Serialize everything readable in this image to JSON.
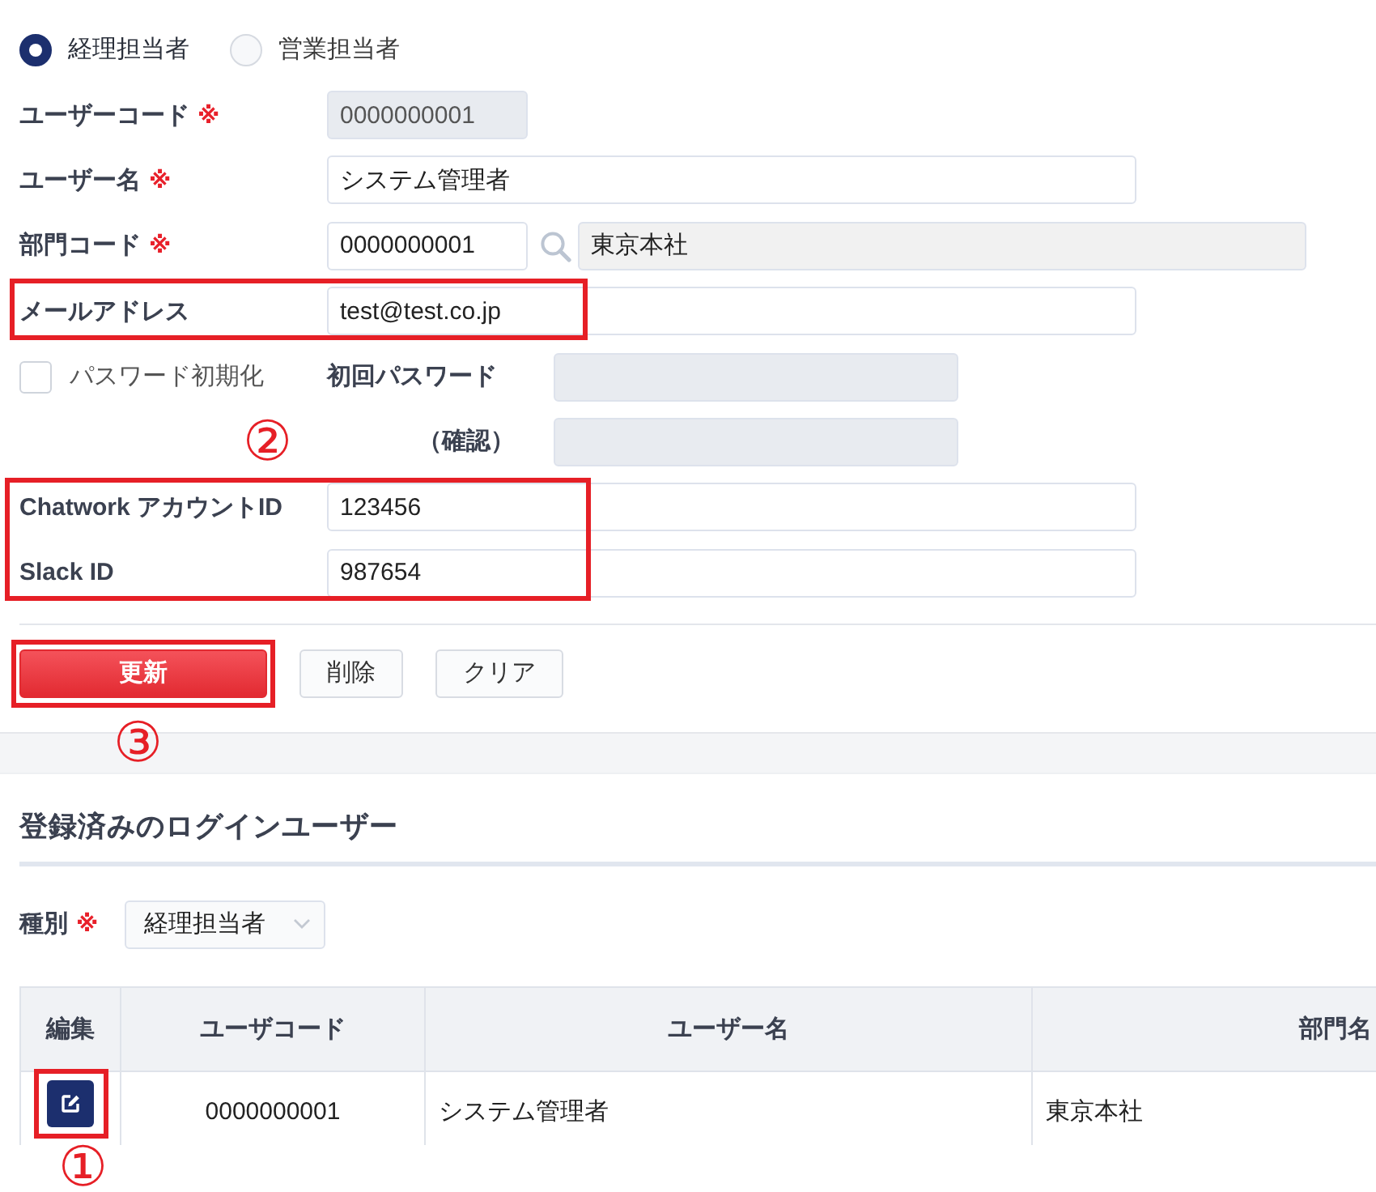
{
  "user_type": [
    {
      "label": "経理担当者",
      "selected": true
    },
    {
      "label": "営業担当者",
      "selected": false
    }
  ],
  "form": {
    "fields": [
      {
        "kind": "code",
        "label": "ユーザーコード",
        "mark": "※",
        "value": "0000000001",
        "disabled": true,
        "highlighted": false
      },
      {
        "kind": "text",
        "label": "ユーザー名",
        "mark": "※",
        "value": "システム管理者",
        "disabled": false,
        "highlighted": false
      },
      {
        "kind": "lookup",
        "label": "部門コード",
        "mark": "※",
        "value": "0000000001",
        "disabled": false,
        "highlighted": false,
        "name": {
          "value": "東京本社",
          "disabled": true
        }
      },
      {
        "kind": "text",
        "label": "メールアドレス",
        "value": "test@test.co.jp",
        "disabled": false,
        "highlighted": true
      }
    ],
    "password": {
      "reset": {
        "label": "パスワード初期化",
        "checked": false
      },
      "initial": {
        "label": "初回パスワード",
        "disabled": true
      },
      "confirm": {
        "label": "（確認）",
        "disabled": true
      }
    },
    "accounts": {
      "highlighted": true,
      "callout": "②",
      "fields": [
        {
          "label": "Chatwork アカウントID",
          "value": "123456",
          "disabled": false
        },
        {
          "label": "Slack ID",
          "value": "987654",
          "disabled": false
        }
      ]
    }
  },
  "buttons": [
    {
      "label": "更新",
      "kind": "primary",
      "highlighted": true,
      "callout": "③"
    },
    {
      "label": "削除",
      "kind": "default",
      "highlighted": false
    },
    {
      "label": "クリア",
      "kind": "default",
      "highlighted": false
    }
  ],
  "registered": {
    "title": "登録済みのログインユーザー",
    "filter": {
      "label": "種別",
      "mark": "※",
      "value": "経理担当者"
    },
    "table": {
      "columns": [
        "編集",
        "ユーザコード",
        "ユーザー名",
        "部門名"
      ],
      "rows": [
        {
          "cells": [
            {
              "kind": "edit",
              "highlighted": true,
              "callout": "①"
            },
            {
              "kind": "text",
              "text": "0000000001"
            },
            {
              "kind": "text",
              "text": "システム管理者"
            },
            {
              "kind": "text",
              "text": "東京本社"
            }
          ]
        }
      ]
    }
  }
}
